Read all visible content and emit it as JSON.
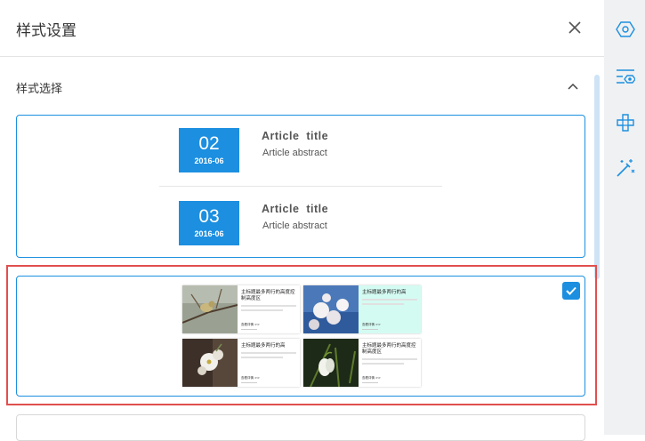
{
  "header": {
    "title": "样式设置"
  },
  "section": {
    "title": "样式选择"
  },
  "styles": {
    "option1": {
      "articles": [
        {
          "day": "02",
          "year_month": "2016-06",
          "title": "Article title",
          "abstract": "Article abstract"
        },
        {
          "day": "03",
          "year_month": "2016-06",
          "title": "Article title",
          "abstract": "Article abstract"
        }
      ]
    },
    "option2": {
      "selected": true,
      "tiles": [
        {
          "title": "主标题最多两行的高度控制高度区",
          "foot": "查看详情 >>",
          "highlight": false
        },
        {
          "title": "主标题最多两行的高",
          "foot": "查看详情 >>",
          "highlight": true
        },
        {
          "title": "主标题最多两行的高",
          "foot": "查看详情 >>",
          "highlight": false
        },
        {
          "title": "主标题最多两行的高度控制高度区",
          "foot": "查看详情 >>",
          "highlight": false
        }
      ]
    }
  },
  "sidebar": {
    "icons": [
      "settings-hex-icon",
      "style-list-icon",
      "component-plus-icon",
      "magic-wand-icon"
    ],
    "active": "style-list-icon"
  },
  "colors": {
    "accent": "#1c8fe0",
    "selection": "#e0504f",
    "mint": "#d4fbf2",
    "rail": "#f0f1f3"
  }
}
